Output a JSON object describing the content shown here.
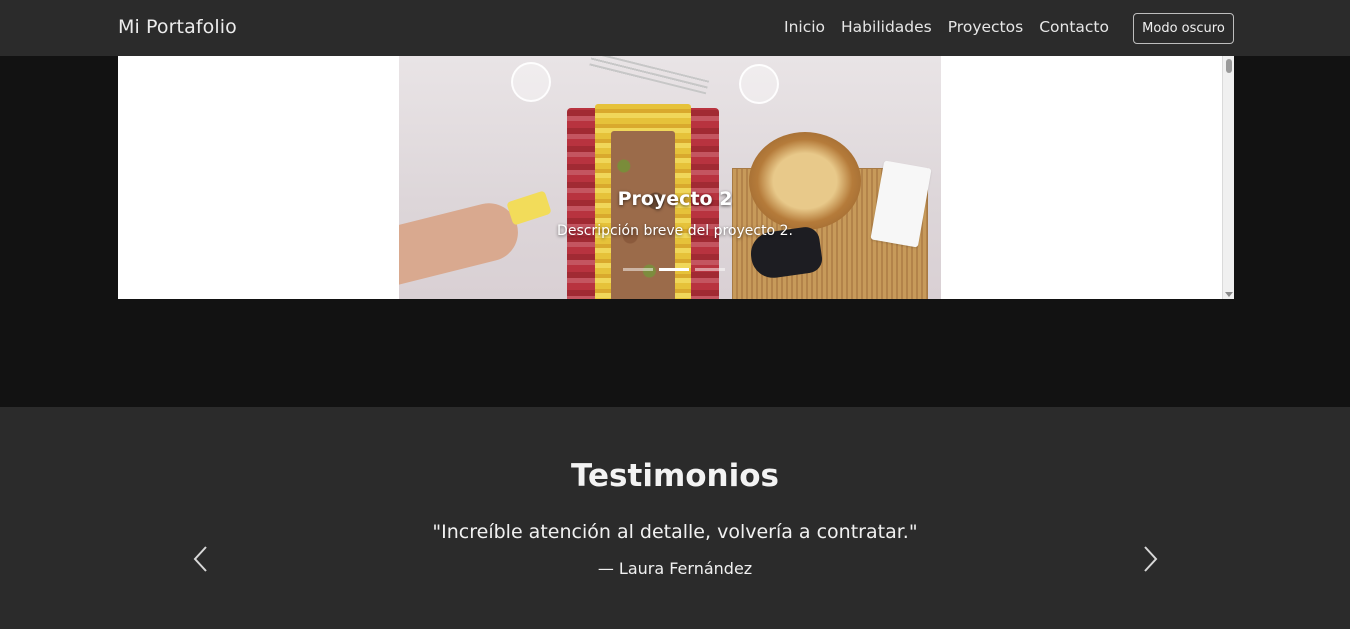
{
  "navbar": {
    "brand": "Mi Portafolio",
    "links": [
      "Inicio",
      "Habilidades",
      "Proyectos",
      "Contacto"
    ],
    "mode_button": "Modo oscuro"
  },
  "carousel": {
    "active_index": 1,
    "slide_count": 3,
    "caption_title": "Proyecto 2",
    "caption_description": "Descripción breve del proyecto 2."
  },
  "testimonials": {
    "title": "Testimonios",
    "quote": "\"Increíble atención al detalle, volvería a contratar.\"",
    "author": "— Laura Fernández"
  },
  "colors": {
    "navbar_bg": "#2b2b2b",
    "page_bg": "#121212",
    "section_bg": "#2b2b2b",
    "text": "#f1f1f1"
  }
}
